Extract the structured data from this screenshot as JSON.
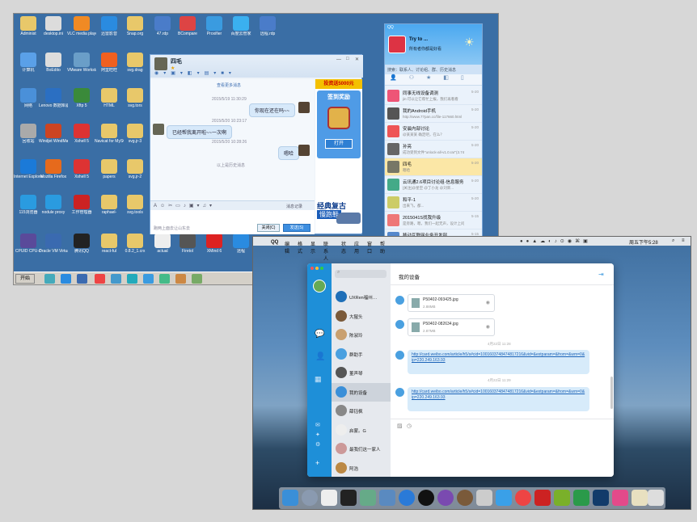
{
  "windows_desktop": {
    "icons": [
      {
        "label": "Administ",
        "color": "#e8c86a"
      },
      {
        "label": "desktop.ini",
        "color": "#dcdcdc"
      },
      {
        "label": "VLC media player",
        "color": "#f08a24"
      },
      {
        "label": "迅雷影音",
        "color": "#2a8be0"
      },
      {
        "label": "Snap.org",
        "color": "#e8c86a"
      },
      {
        "label": "47.rdp",
        "color": "#4a7cc9"
      },
      {
        "label": "BCompare",
        "color": "#d44"
      },
      {
        "label": "Proxifier",
        "color": "#3a9be0"
      },
      {
        "label": "百度云管家",
        "color": "#3ab0f0"
      },
      {
        "label": "远程.rdp",
        "color": "#4a7cc9"
      },
      {
        "label": "计算机",
        "color": "#5aa0e8"
      },
      {
        "label": "BoEdito",
        "color": "#ddd"
      },
      {
        "label": "VMware Workstation",
        "color": "#6a9ec8"
      },
      {
        "label": "阿里旺旺",
        "color": "#f06020"
      },
      {
        "label": "svg.drag",
        "color": "#e8c86a"
      },
      {
        "label": "网络",
        "color": "#4a90d9"
      },
      {
        "label": "Lenovo 数据库驱动管理",
        "color": "#2b6fc2"
      },
      {
        "label": "Xftp 5",
        "color": "#3a8a3a"
      },
      {
        "label": "HTML",
        "color": "#e8c86a"
      },
      {
        "label": "svg.tors",
        "color": "#e8c86a"
      },
      {
        "label": "回收站",
        "color": "#aaa"
      },
      {
        "label": "Windjet WindMaker",
        "color": "#c42"
      },
      {
        "label": "Xshell 5",
        "color": "#d33"
      },
      {
        "label": "Navicat for MySQL",
        "color": "#e8c86a"
      },
      {
        "label": "svg.jr-3",
        "color": "#e8c86a"
      },
      {
        "label": "Internet Explorer",
        "color": "#1b7ad8"
      },
      {
        "label": "Mozilla Firefox",
        "color": "#e66a1c"
      },
      {
        "label": "Xshell 5",
        "color": "#d33"
      },
      {
        "label": "papers",
        "color": "#e8c86a"
      },
      {
        "label": "svg.jr-2",
        "color": "#e8c86a"
      },
      {
        "label": "115浏览器",
        "color": "#2a9be0"
      },
      {
        "label": "nodule proxy",
        "color": "#2a9be0"
      },
      {
        "label": "工作管理器",
        "color": "#c22"
      },
      {
        "label": "raphael-",
        "color": "#e8c86a"
      },
      {
        "label": "svg.tools",
        "color": "#e8c86a"
      },
      {
        "label": "CPUID CPU-Z",
        "color": "#5a4a9a"
      },
      {
        "label": "Oracle VM VirtualBox",
        "color": "#3a6ab0"
      },
      {
        "label": "腾讯QQ",
        "color": "#222"
      },
      {
        "label": "react-ful",
        "color": "#e8c86a"
      },
      {
        "label": "0.8.2_1.crx",
        "color": "#e8c86a"
      },
      {
        "label": "actual",
        "color": "#eee"
      },
      {
        "label": "Firetol",
        "color": "#555"
      },
      {
        "label": "XMind 6",
        "color": "#d22"
      },
      {
        "label": "远程",
        "color": "#2a8be0"
      }
    ],
    "taskbar": {
      "start_label": "开始"
    }
  },
  "qq_chat_window": {
    "contact_name": "四毛",
    "history_link": "查看更多消息",
    "messages": [
      {
        "time": "2015/5/19 11:30:29",
        "text": "你现在还在吗~~",
        "side": "right"
      },
      {
        "time": "2015/5/20 10:23:17",
        "text": "已经帮我离开啦~~一次啊",
        "side": "left"
      },
      {
        "time": "2015/5/20 10:28:26",
        "text": "嗯哈",
        "side": "right"
      }
    ],
    "history_divider": "以上是历史消息",
    "msg_record": "消息记录",
    "footer_tip": "跑两上面去让山东去",
    "close_button": "关闭(C)",
    "send_button": "发送(S)",
    "ad_top": "投资送5000元",
    "ad_sign": "签到奖励",
    "ad_open": "打开",
    "ad_bottom_title": "经典复古",
    "ad_bottom_sub": "慢跑鞋"
  },
  "qq_main": {
    "title": "QQ",
    "user_name": "Try to ...",
    "user_status": "所有者你都是好看",
    "search_placeholder": "搜索：联系人、讨论组、群、历史消息",
    "contacts": [
      {
        "name": "同事无线设备调测",
        "msg": "jin:可以让它帮忙上报，我们再看看",
        "date": "5-20",
        "color": "#e57"
      },
      {
        "name": "我的Android手机",
        "msg": "http://www.77pan.cc/file-117660.html",
        "date": "5-20",
        "color": "#555"
      },
      {
        "name": "安晨内部讨论",
        "msg": "@某某某 确定吧，在么？",
        "date": "5-20",
        "color": "#e55"
      },
      {
        "name": "孙亮",
        "msg": "成功受到文件\"unlock-all-v1.0.rar\"(3.74",
        "date": "5-20",
        "color": "#666"
      },
      {
        "name": "四毛",
        "msg": "嗯哈",
        "date": "5-20",
        "color": "#776",
        "selected": true
      },
      {
        "name": "云讯通2.6项目讨论组-信息服务",
        "msg": "[关注]@星空 @丁小龙 @刘荣...",
        "date": "5-20",
        "color": "#4a8"
      },
      {
        "name": "和平-1",
        "msg": "出来飞，都...",
        "date": "5-20",
        "color": "#cc6"
      },
      {
        "name": "2015041S找我升级",
        "msg": "是旁路，嗯，我们一起无声，设计上问题",
        "date": "5-15",
        "color": "#e77"
      },
      {
        "name": "移动互联网业务开发部",
        "msg": "",
        "date": "5-15",
        "color": "#58c"
      }
    ]
  },
  "mac_desktop": {
    "menubar": {
      "apple": "",
      "items": [
        "QQ",
        "编辑",
        "格式",
        "显示",
        "联系人",
        "状态",
        "应用",
        "窗口",
        "帮助"
      ],
      "clock": "周五下午5:28"
    },
    "chat_title": "我的设备",
    "contacts": [
      {
        "name": "UXRen福州…",
        "color": "#1e6fb8"
      },
      {
        "name": "大猩头",
        "color": "#7a5a3a"
      },
      {
        "name": "陈淑玲",
        "color": "#c9a070"
      },
      {
        "name": "群助手",
        "color": "#4aa0e0"
      },
      {
        "name": "董声琴",
        "color": "#555"
      },
      {
        "name": "我的设备",
        "color": "#3a8fd8",
        "selected": true
      },
      {
        "name": "薛钰枫",
        "color": "#888"
      },
      {
        "name": "启蒙。G",
        "color": "#eee"
      },
      {
        "name": "最我们这一家人",
        "color": "#c99"
      },
      {
        "name": "阿浩",
        "color": "#b84"
      }
    ],
    "files": [
      {
        "name": "P50402-093425.jpg",
        "size": "2.88MB"
      },
      {
        "name": "P50402-082634.jpg",
        "size": "2.87MB"
      }
    ],
    "time1": "4月22日 11:28",
    "time2": "4月22日 11:29",
    "link1": "http://card.weibo.com/article/h5/s#cid=1001603748474817216&vid=&extparam=&from=&wm=0&ip=220.249.163.93",
    "link2": "http://card.weibo.com/article/h5/s#cid=1001603748474817216&vid=&extparam=&from=&wm=0&ip=220.249.163.93"
  }
}
